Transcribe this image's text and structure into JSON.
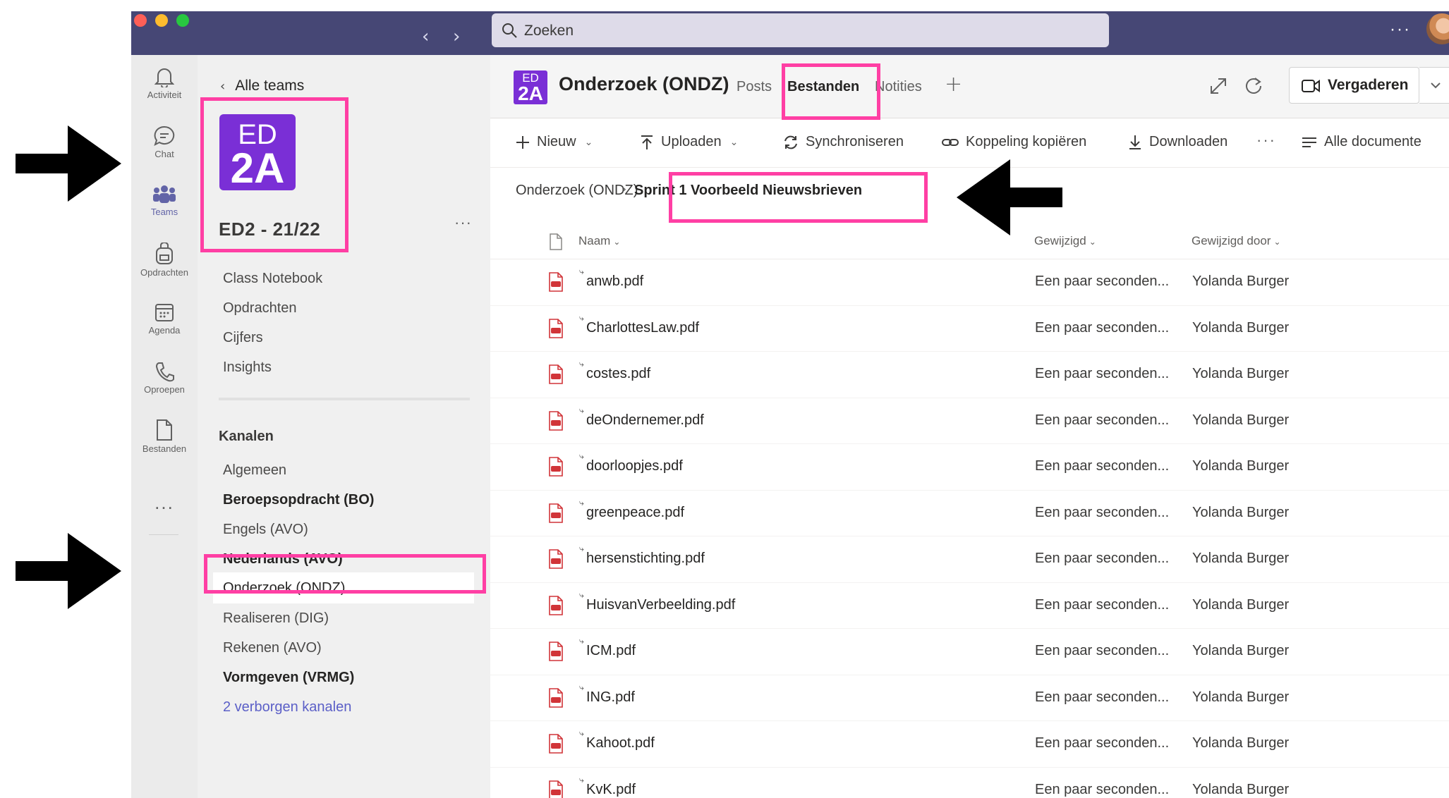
{
  "search": {
    "placeholder": "Zoeken"
  },
  "rail": [
    {
      "label": "Activiteit",
      "icon": "bell-icon"
    },
    {
      "label": "Chat",
      "icon": "chat-icon"
    },
    {
      "label": "Teams",
      "icon": "teams-icon",
      "active": true
    },
    {
      "label": "Opdrachten",
      "icon": "backpack-icon"
    },
    {
      "label": "Agenda",
      "icon": "calendar-icon"
    },
    {
      "label": "Oproepen",
      "icon": "phone-icon"
    },
    {
      "label": "Bestanden",
      "icon": "file-icon"
    }
  ],
  "rail_more": "...",
  "team": {
    "back_label": "Alle teams",
    "tile_line1": "ED",
    "tile_line2": "2A",
    "name": "ED2 - 21/22",
    "more": "···",
    "links": [
      "Class Notebook",
      "Opdrachten",
      "Cijfers",
      "Insights"
    ],
    "channels_heading": "Kanalen",
    "channels": [
      {
        "label": "Algemeen",
        "style": "normal"
      },
      {
        "label": "Beroepsopdracht (BO)",
        "style": "bold"
      },
      {
        "label": "Engels (AVO)",
        "style": "normal"
      },
      {
        "label": "Nederlands (AVO)",
        "style": "bold"
      },
      {
        "label": "Onderzoek (ONDZ)",
        "style": "active"
      },
      {
        "label": "Realiseren (DIG)",
        "style": "normal"
      },
      {
        "label": "Rekenen (AVO)",
        "style": "normal"
      },
      {
        "label": "Vormgeven (VRMG)",
        "style": "bold"
      },
      {
        "label": "2 verborgen kanalen",
        "style": "link"
      }
    ]
  },
  "channel": {
    "logo_line1": "ED",
    "logo_line2": "2A",
    "title": "Onderzoek (ONDZ)",
    "tabs": [
      {
        "label": "Posts"
      },
      {
        "label": "Bestanden",
        "active": true
      },
      {
        "label": "Notities"
      }
    ],
    "meet_label": "Vergaderen"
  },
  "toolbar": {
    "new": "Nieuw",
    "upload": "Uploaden",
    "sync": "Synchroniseren",
    "copy_link": "Koppeling kopiëren",
    "download": "Downloaden",
    "more": "···",
    "all_docs": "Alle documente"
  },
  "breadcrumb": {
    "parent": "Onderzoek (ONDZ)",
    "current": "Sprint 1 Voorbeeld Nieuwsbrieven"
  },
  "table": {
    "columns": [
      "Naam",
      "Gewijzigd",
      "Gewijzigd door"
    ],
    "rows": [
      {
        "name": "anwb.pdf",
        "modified": "Een paar seconden...",
        "by": "Yolanda Burger"
      },
      {
        "name": "CharlottesLaw.pdf",
        "modified": "Een paar seconden...",
        "by": "Yolanda Burger"
      },
      {
        "name": "costes.pdf",
        "modified": "Een paar seconden...",
        "by": "Yolanda Burger"
      },
      {
        "name": "deOndernemer.pdf",
        "modified": "Een paar seconden...",
        "by": "Yolanda Burger"
      },
      {
        "name": "doorloopjes.pdf",
        "modified": "Een paar seconden...",
        "by": "Yolanda Burger"
      },
      {
        "name": "greenpeace.pdf",
        "modified": "Een paar seconden...",
        "by": "Yolanda Burger"
      },
      {
        "name": "hersenstichting.pdf",
        "modified": "Een paar seconden...",
        "by": "Yolanda Burger"
      },
      {
        "name": "HuisvanVerbeelding.pdf",
        "modified": "Een paar seconden...",
        "by": "Yolanda Burger"
      },
      {
        "name": "ICM.pdf",
        "modified": "Een paar seconden...",
        "by": "Yolanda Burger"
      },
      {
        "name": "ING.pdf",
        "modified": "Een paar seconden...",
        "by": "Yolanda Burger"
      },
      {
        "name": "Kahoot.pdf",
        "modified": "Een paar seconden...",
        "by": "Yolanda Burger"
      },
      {
        "name": "KvK.pdf",
        "modified": "Een paar seconden...",
        "by": "Yolanda Burger"
      }
    ]
  },
  "colors": {
    "titlebar": "#464775",
    "brand": "#6264a7",
    "team_tile": "#7a2fd6",
    "highlight": "#ff3fa4",
    "pdf_icon": "#d13438"
  }
}
